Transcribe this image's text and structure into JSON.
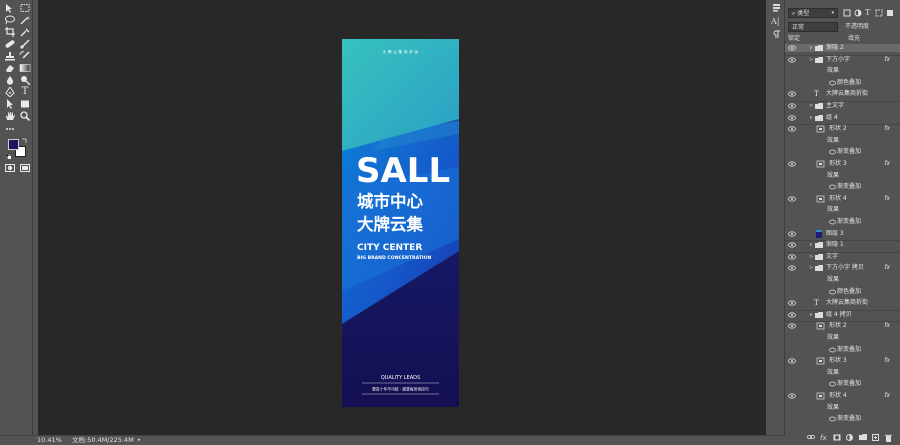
{
  "app": {
    "name": "Photoshop"
  },
  "toolbar": {
    "tools": [
      "move-tool",
      "marquee-tool",
      "lasso-tool",
      "magic-wand-tool",
      "crop-tool",
      "eyedropper-tool",
      "healing-tool",
      "brush-tool",
      "stamp-tool",
      "history-brush-tool",
      "eraser-tool",
      "gradient-tool",
      "blur-tool",
      "dodge-tool",
      "pen-tool",
      "type-tool",
      "path-select-tool",
      "shape-tool",
      "hand-tool",
      "zoom-tool",
      "more-tools"
    ],
    "type_glyph": "T",
    "foreground_color": "#1b1560",
    "background_color": "#ffffff"
  },
  "status": {
    "zoom": "10.41%",
    "doc_info": "文档:50.4M/225.4M"
  },
  "poster": {
    "top_text": "大 牌 云 集 商 折 街",
    "headline": "SALL",
    "cn_line1": "城市中心",
    "cn_line2": "大牌云集",
    "en_title": "CITY CENTER",
    "en_sub": "BIG BRAND CONCENTRATION",
    "quality": "QUALITY LEADS",
    "slogan": "要进十年不可抵 · 感受每份供应行"
  },
  "layers": {
    "filter_label": "类型",
    "blend_label": "正常",
    "opacity_label": "不透明度",
    "lock_label": "锁定",
    "fill_label": "填充",
    "rows": [
      {
        "label": "渐隐 2",
        "type": "group-open",
        "selected": true
      },
      {
        "label": "下方小字",
        "type": "group",
        "fx": "fx"
      },
      {
        "label": "效果",
        "type": "effect"
      },
      {
        "label": "颜色叠加",
        "type": "effect-item"
      },
      {
        "label": "大牌云集商折街",
        "type": "text"
      },
      {
        "label": "主文字",
        "type": "group"
      },
      {
        "label": "组 4",
        "type": "group-open"
      },
      {
        "label": "形状 2",
        "type": "shape",
        "fx": "fx"
      },
      {
        "label": "效果",
        "type": "effect"
      },
      {
        "label": "渐变叠加",
        "type": "effect-item"
      },
      {
        "label": "形状 3",
        "type": "shape",
        "fx": "fx"
      },
      {
        "label": "效果",
        "type": "effect"
      },
      {
        "label": "渐变叠加",
        "type": "effect-item"
      },
      {
        "label": "形状 4",
        "type": "shape",
        "fx": "fx"
      },
      {
        "label": "效果",
        "type": "effect"
      },
      {
        "label": "渐变叠加",
        "type": "effect-item"
      },
      {
        "label": "图层 3",
        "type": "pixel"
      },
      {
        "label": "渐隐 1",
        "type": "group-open"
      },
      {
        "label": "文字",
        "type": "group"
      },
      {
        "label": "下方小字 拷贝",
        "type": "group",
        "fx": "fx"
      },
      {
        "label": "效果",
        "type": "effect"
      },
      {
        "label": "颜色叠加",
        "type": "effect-item"
      },
      {
        "label": "大牌云集商折街",
        "type": "text"
      },
      {
        "label": "组 4 拷贝",
        "type": "group-open"
      },
      {
        "label": "形状 2",
        "type": "shape",
        "fx": "fx"
      },
      {
        "label": "效果",
        "type": "effect"
      },
      {
        "label": "渐变叠加",
        "type": "effect-item"
      },
      {
        "label": "形状 3",
        "type": "shape",
        "fx": "fx"
      },
      {
        "label": "效果",
        "type": "effect"
      },
      {
        "label": "渐变叠加",
        "type": "effect-item"
      },
      {
        "label": "形状 4",
        "type": "shape",
        "fx": "fx"
      },
      {
        "label": "效果",
        "type": "effect"
      },
      {
        "label": "渐变叠加",
        "type": "effect-item"
      }
    ],
    "footer": [
      "link-icon",
      "fx-icon",
      "mask-icon",
      "adjustment-icon",
      "folder-icon",
      "new-layer-icon",
      "trash-icon"
    ]
  }
}
